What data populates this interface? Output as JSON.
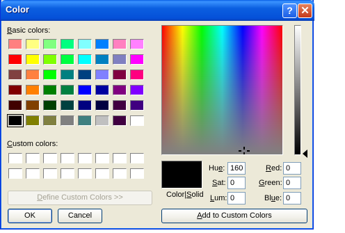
{
  "window": {
    "title": "Color",
    "help_glyph": "?",
    "close_glyph": "✕"
  },
  "labels": {
    "basic_colors_key": "B",
    "basic_colors_rest": "asic colors:",
    "custom_colors_key": "C",
    "custom_colors_rest": "ustom colors:",
    "color_solid_a": "Color",
    "color_solid_sep": "|",
    "color_solid_key": "S",
    "color_solid_b": "olid",
    "hue_key": "e",
    "hue_pre": "Hu",
    "hue_post": ":",
    "sat_key": "S",
    "sat_rest": "at:",
    "lum_key": "L",
    "lum_rest": "um:",
    "red_key": "R",
    "red_rest": "ed:",
    "green_key": "G",
    "green_rest": "reen:",
    "blue_key": "u",
    "blue_pre": "Bl",
    "blue_post": "e:"
  },
  "values": {
    "hue": "160",
    "sat": "0",
    "lum": "0",
    "red": "0",
    "green": "0",
    "blue": "0"
  },
  "buttons": {
    "define_custom_key": "D",
    "define_custom_rest": "efine Custom Colors >>",
    "ok": "OK",
    "cancel": "Cancel",
    "add_custom_key": "A",
    "add_custom_rest": "dd to Custom Colors"
  },
  "basic_colors": [
    [
      "#ff8080",
      "#ffff80",
      "#80ff80",
      "#00ff80",
      "#80ffff",
      "#0080ff",
      "#ff80c0",
      "#ff80ff"
    ],
    [
      "#ff0000",
      "#ffff00",
      "#80ff00",
      "#00ff40",
      "#00ffff",
      "#0080c0",
      "#8080c0",
      "#ff00ff"
    ],
    [
      "#804040",
      "#ff8040",
      "#00ff00",
      "#008080",
      "#004080",
      "#8080ff",
      "#800040",
      "#ff0080"
    ],
    [
      "#800000",
      "#ff8000",
      "#008000",
      "#008040",
      "#0000ff",
      "#0000a0",
      "#800080",
      "#8000ff"
    ],
    [
      "#400000",
      "#804000",
      "#004000",
      "#004040",
      "#000080",
      "#000040",
      "#400040",
      "#400080"
    ],
    [
      "#000000",
      "#808000",
      "#808040",
      "#808080",
      "#408080",
      "#c0c0c0",
      "#400040",
      "#ffffff"
    ]
  ],
  "selected_basic": "#000000",
  "custom_colors": [
    "#ffffff",
    "#ffffff",
    "#ffffff",
    "#ffffff",
    "#ffffff",
    "#ffffff",
    "#ffffff",
    "#ffffff",
    "#ffffff",
    "#ffffff",
    "#ffffff",
    "#ffffff",
    "#ffffff",
    "#ffffff",
    "#ffffff",
    "#ffffff"
  ],
  "current_color": "#000000"
}
